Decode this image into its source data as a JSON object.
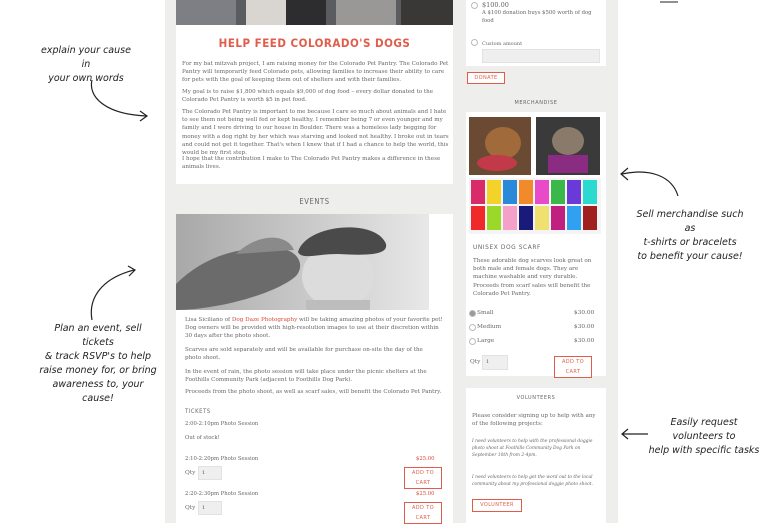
{
  "annotations": {
    "explain": [
      "explain your cause in",
      "your own words"
    ],
    "events": [
      "Plan an event, sell tickets",
      "& track RSVP's to help",
      "raise money for, or bring",
      "awareness to, your cause!"
    ],
    "merch": [
      "Sell merchandise such as",
      "t-shirts or bracelets",
      "to benefit your cause!"
    ],
    "volunteers": [
      "Easily request volunteers to",
      "help with specific tasks"
    ]
  },
  "cause": {
    "title": "HELP FEED COLORADO'S DOGS",
    "p1": "For my bat mitzvah project, I am raising money for the Colorado Pet Pantry. The Colorado Pet Pantry will temporarily feed Colorado pets, allowing families to increase their ability to care for pets with the goal of keeping them out of shelters and with their families.",
    "p2": "My goal is to raise $1,800 which equals $9,000 of dog food – every dollar donated to the Colorado Pet Pantry is worth $5 in pet food.",
    "p3": "The Colorado Pet Pantry is important to me because I care so much about animals and I hate to see them not being well fed or kept healthy. I remember being 7 or even younger and my family and I were driving to our house in Boulder. There was a homeless lady begging for money with a dog right by her which was starving and looked not healthy. I broke out in tears and could not get it together. That's when I knew that if I had a chance to help the world, this would be my first step.",
    "p4": "I hope that the contribution I make to The Colorado Pet Pantry makes a difference in these animals lives."
  },
  "donate": {
    "amount": "$100.00",
    "amount_desc": "A $100 donation buys $500 worth of dog food",
    "custom_label": "Custom amount",
    "button": "DONATE"
  },
  "events": {
    "heading": "EVENTS",
    "p1_pre": "Lisa Siciliano of ",
    "p1_link": "Dog Daze Photography",
    "p1_post": " will be taking amazing photos of your favorite pet! Dog owners will be provided with high-resolution images to use at their discretion within 30 days after the photo shoot.",
    "p2": "Scarves are sold separately and will be available for purchase on-site the day of the photo shoot.",
    "p3": "In the event of rain, the photo session will take place under the picnic shelters at the Foothills Community Park (adjacent to Foothills Dog Park).",
    "p4": "Proceeds from the photo shoot, as well as scarf sales, will benefit the Colorado Pet Pantry.",
    "tickets_heading": "TICKETS",
    "tickets": [
      {
        "time": "2:00-2:10pm Photo Session",
        "status": "Out of stock!"
      },
      {
        "time": "2:10-2:20pm Photo Session",
        "price": "$25.00",
        "qty_label": "Qty",
        "qty": "1",
        "button": "ADD TO CART"
      },
      {
        "time": "2:20-2:30pm Photo Session",
        "price": "$25.00",
        "qty_label": "Qty",
        "qty": "1",
        "button": "ADD TO CART"
      }
    ]
  },
  "merch": {
    "heading": "MERCHANDISE",
    "product_title": "UNISEX DOG SCARF",
    "product_desc": "These adorable dog scarves look great on both male and female dogs. They are machine washable and very durable. Proceeds from scarf sales will benefit the Colorado Pet Pantry.",
    "sizes": [
      {
        "name": "Small",
        "price": "$30.00"
      },
      {
        "name": "Medium",
        "price": "$30.00"
      },
      {
        "name": "Large",
        "price": "$30.00"
      }
    ],
    "qty_label": "Qty",
    "qty": "1",
    "button": "ADD TO CART"
  },
  "volunteers": {
    "heading": "VOLUNTEERS",
    "intro": "Please consider signing up to help with any of the following projects:",
    "item1": "I need volunteers to help with the professional doggie photo shoot at Foothills Community Dog Park on September 10th from 2-4pm.",
    "item2": "I need volunteers to help get the word out to the local community about my professional doggie photo shoot.",
    "button": "VOLUNTEER"
  },
  "colors": {
    "accent": "#e05d4b",
    "panel": "#eeeeec"
  }
}
